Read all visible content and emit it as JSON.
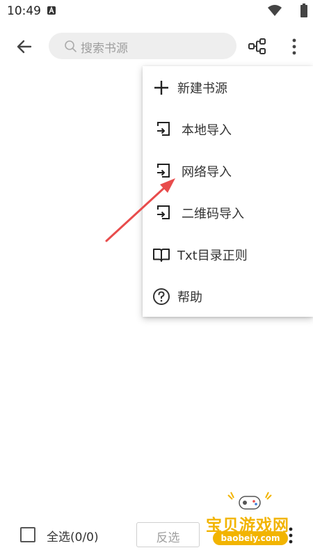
{
  "status_bar": {
    "time": "10:49",
    "icons": [
      "a-notification-icon",
      "wifi-icon",
      "battery-icon"
    ]
  },
  "toolbar": {
    "back_icon": "arrow-back-icon",
    "search_placeholder": "搜索书源",
    "group_icon": "group-structure-icon",
    "more_icon": "more-vert-icon"
  },
  "menu": {
    "items": [
      {
        "label": "新建书源",
        "icon": "plus-icon"
      },
      {
        "label": "本地导入",
        "icon": "import-icon"
      },
      {
        "label": "网络导入",
        "icon": "import-icon"
      },
      {
        "label": "二维码导入",
        "icon": "import-icon"
      },
      {
        "label": "Txt目录正则",
        "icon": "book-icon"
      },
      {
        "label": "帮助",
        "icon": "help-icon"
      }
    ]
  },
  "bottom_bar": {
    "select_all_label": "全选(0/0)",
    "invert_label": "反选",
    "more_icon": "more-vert-icon"
  },
  "watermark": {
    "title": "宝贝游戏网",
    "site": "baobeiy.com"
  },
  "colors": {
    "annotation_arrow": "#e84c4c",
    "watermark": "#f2b400",
    "search_bg": "#eeeeee"
  }
}
